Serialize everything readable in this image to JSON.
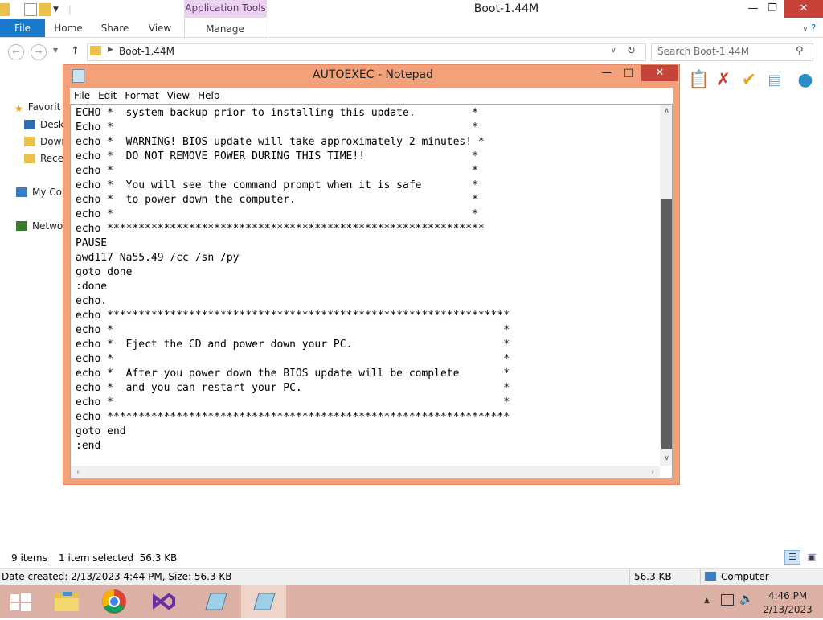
{
  "explorer": {
    "title": "Boot-1.44M",
    "contextual_tab_group": "Application Tools",
    "tabs": [
      "File",
      "Home",
      "Share",
      "View",
      "Manage"
    ],
    "address": "Boot-1.44M",
    "search_placeholder": "Search Boot-1.44M",
    "nav_items": [
      "Favorit",
      "Deskt",
      "Down",
      "Recer",
      "My Co",
      "Networ"
    ],
    "status_items": "9 items",
    "status_selected": "1 item selected  56.3 KB",
    "details_text": "Date created: 2/13/2023 4:44 PM, Size: 56.3 KB",
    "details_size": "56.3 KB",
    "details_location": "Computer",
    "help_glyph": "?"
  },
  "notepad": {
    "title": "AUTOEXEC - Notepad",
    "menu": [
      "File",
      "Edit",
      "Format",
      "View",
      "Help"
    ],
    "lines": [
      "ECHO *  system backup prior to installing this update.         *",
      "Echo *                                                         *",
      "echo *  WARNING! BIOS update will take approximately 2 minutes! *",
      "echo *  DO NOT REMOVE POWER DURING THIS TIME!!                 *",
      "echo *                                                         *",
      "echo *  You will see the command prompt when it is safe        *",
      "echo *  to power down the computer.                            *",
      "echo *                                                         *",
      "echo ************************************************************",
      "PAUSE",
      "awd117 Na55.49 /cc /sn /py",
      "goto done",
      ":done",
      "echo.",
      "echo ****************************************************************",
      "echo *                                                              *",
      "echo *  Eject the CD and power down your PC.                        *",
      "echo *                                                              *",
      "echo *  After you power down the BIOS update will be complete       *",
      "echo *  and you can restart your PC.                                *",
      "echo *                                                              *",
      "echo ****************************************************************",
      "goto end",
      ":end"
    ]
  },
  "taskbar": {
    "apps": [
      "start-icon",
      "file-explorer-icon",
      "chrome-icon",
      "visual-studio-icon",
      "notepad-icon",
      "notepad-icon"
    ],
    "time": "4:46 PM",
    "date": "2/13/2023"
  },
  "colors": {
    "accent": "#1979ca",
    "notepad_frame": "#f3a17b",
    "close_button": "#c7433a",
    "taskbar": "#dcb0a4"
  }
}
